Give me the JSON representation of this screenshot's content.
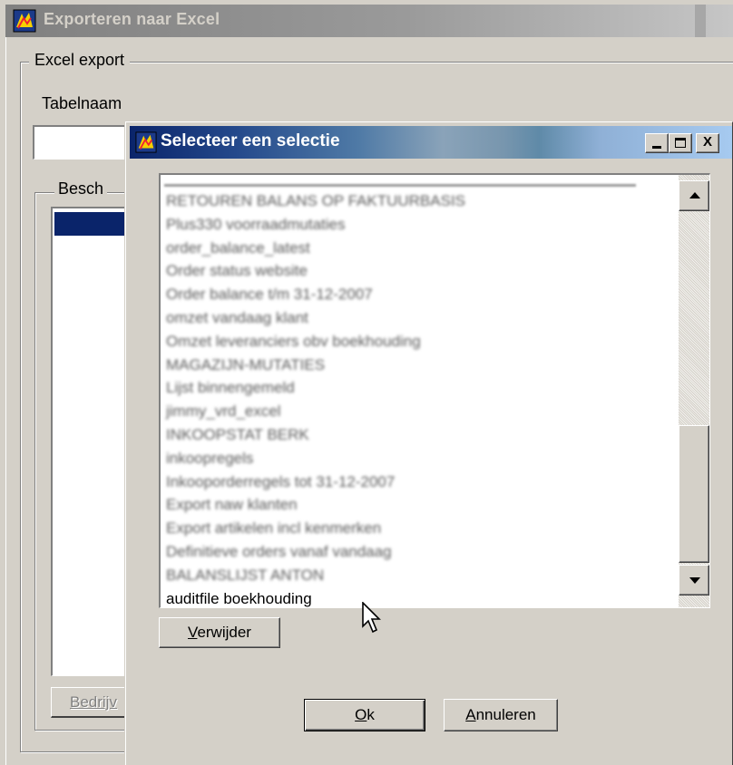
{
  "background_window": {
    "title": "Exporteren naar Excel",
    "group_label": "Excel export",
    "tabelnaam_label": "Tabelnaam",
    "tabelnaam_value": "",
    "besch_group_label": "Besch",
    "bedrijf_button_label": "Bedrijv"
  },
  "dialog": {
    "title": "Selecteer een selectie",
    "title_buttons": {
      "minimize": "_",
      "maximize": "□",
      "close": "X"
    },
    "list_items": [
      "RETOUREN BALANS OP FAKTUURBASIS",
      "Plus330 voorraadmutaties",
      "order_balance_latest",
      "Order status website",
      "Order balance t/m 31-12-2007",
      "omzet vandaag klant",
      "Omzet leveranciers obv boekhouding",
      "MAGAZIJN-MUTATIES",
      "Lijst binnengemeld",
      "jimmy_vrd_excel",
      "INKOOPSTAT BERK",
      "inkoopregels",
      "Inkooporderregels tot 31-12-2007",
      "Export naw klanten",
      "Export artikelen incl kenmerken",
      "Definitieve orders vanaf vandaag",
      "BALANSLIJST ANTON",
      "auditfile boekhouding"
    ],
    "verwijder_label": "Verwijder",
    "verwijder_mnemonic": "V",
    "verwijder_rest": "erwijder",
    "ok_label": "Ok",
    "ok_mnemonic": "O",
    "ok_rest": "k",
    "annuleren_label": "Annuleren",
    "annuleren_mnemonic": "A",
    "annuleren_rest": "nnuleren"
  },
  "colors": {
    "face": "#d4d0c8",
    "active_title_start": "#0a246a",
    "active_title_end": "#a6caf0",
    "inactive_title": "#808080",
    "selection": "#0a246a"
  },
  "icons": [
    "app-icon",
    "minimize-icon",
    "maximize-icon",
    "close-icon",
    "scroll-up-arrow-icon",
    "scroll-down-arrow-icon",
    "mouse-pointer-icon"
  ]
}
